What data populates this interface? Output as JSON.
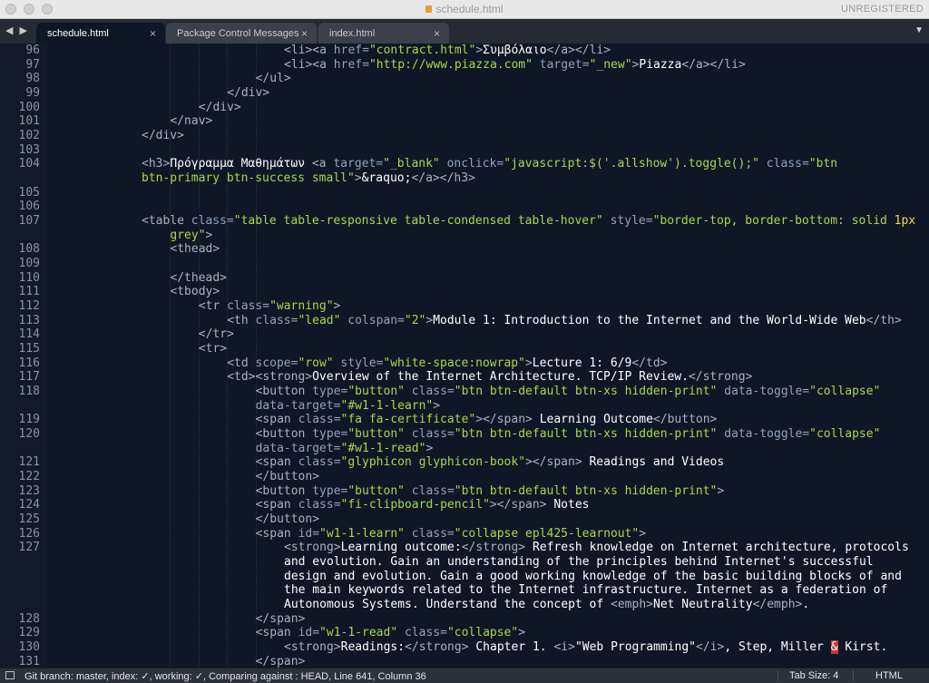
{
  "window": {
    "title": "schedule.html",
    "unregistered": "UNREGISTERED"
  },
  "tabs": [
    {
      "label": "schedule.html",
      "active": true
    },
    {
      "label": "Package Control Messages",
      "active": false
    },
    {
      "label": "index.html",
      "active": false
    }
  ],
  "tab_close": "×",
  "nav_arrows": "◀ ▶",
  "tab_menu": "▼",
  "editor": {
    "lines": [
      {
        "no": "96",
        "indent": 5,
        "tokens": [
          [
            "tg",
            "<li><a "
          ],
          [
            "at",
            "href="
          ],
          [
            "st",
            "\"contract.html\""
          ],
          [
            "tg",
            ">"
          ],
          [
            "tx",
            "Συμβόλαιο"
          ],
          [
            "tg",
            "</a></li>"
          ]
        ]
      },
      {
        "no": "97",
        "indent": 5,
        "tokens": [
          [
            "tg",
            "<li><a "
          ],
          [
            "at",
            "href="
          ],
          [
            "st",
            "\"http://www.piazza.com\""
          ],
          [
            "at",
            " target="
          ],
          [
            "st",
            "\"_new\""
          ],
          [
            "tg",
            ">"
          ],
          [
            "tx",
            "Piazza"
          ],
          [
            "tg",
            "</a></li>"
          ]
        ]
      },
      {
        "no": "98",
        "indent": 4,
        "tokens": [
          [
            "tg",
            "</ul>"
          ]
        ]
      },
      {
        "no": "99",
        "indent": 3,
        "tokens": [
          [
            "tg",
            "</div>"
          ]
        ]
      },
      {
        "no": "100",
        "indent": 2,
        "tokens": [
          [
            "tg",
            "</div>"
          ]
        ]
      },
      {
        "no": "101",
        "indent": 1,
        "tokens": [
          [
            "tg",
            "</nav>"
          ]
        ]
      },
      {
        "no": "102",
        "indent": 0,
        "tokens": [
          [
            "tg",
            "</div>"
          ]
        ]
      },
      {
        "no": "103",
        "indent": 0,
        "tokens": []
      },
      {
        "no": "104",
        "indent": 0,
        "tokens": [
          [
            "tg",
            "<h3>"
          ],
          [
            "tx",
            "Πρόγραμμα Μαθημάτων "
          ],
          [
            "tg",
            "<a "
          ],
          [
            "at",
            "target="
          ],
          [
            "st",
            "\"_blank\""
          ],
          [
            "at",
            " onclick="
          ],
          [
            "st",
            "\"javascript:$('.allshow').toggle();\""
          ],
          [
            "at",
            " class="
          ],
          [
            "st",
            "\"btn"
          ]
        ]
      },
      {
        "no": "",
        "indent": 0,
        "tokens": [
          [
            "st",
            "btn-primary btn-success small\""
          ],
          [
            "tg",
            ">"
          ],
          [
            "tx",
            "&raquo;"
          ],
          [
            "tg",
            "</a></h3>"
          ]
        ]
      },
      {
        "no": "105",
        "indent": 0,
        "tokens": []
      },
      {
        "no": "106",
        "indent": 0,
        "tokens": []
      },
      {
        "no": "107",
        "indent": 0,
        "tokens": [
          [
            "tg",
            "<table "
          ],
          [
            "at",
            "class="
          ],
          [
            "st",
            "\"table table-responsive table-condensed table-hover\""
          ],
          [
            "at",
            " style="
          ],
          [
            "st",
            "\"border-top, border-bottom: solid "
          ],
          [
            "pu",
            "1px"
          ]
        ]
      },
      {
        "no": "",
        "indent": 1,
        "tokens": [
          [
            "st",
            "grey\""
          ],
          [
            "tg",
            ">"
          ]
        ]
      },
      {
        "no": "108",
        "indent": 1,
        "tokens": [
          [
            "tg",
            "<thead>"
          ]
        ]
      },
      {
        "no": "109",
        "indent": 0,
        "tokens": []
      },
      {
        "no": "110",
        "indent": 1,
        "tokens": [
          [
            "tg",
            "</thead>"
          ]
        ]
      },
      {
        "no": "111",
        "indent": 1,
        "tokens": [
          [
            "tg",
            "<tbody>"
          ]
        ]
      },
      {
        "no": "112",
        "indent": 2,
        "tokens": [
          [
            "tg",
            "<tr "
          ],
          [
            "at",
            "class="
          ],
          [
            "st",
            "\"warning\""
          ],
          [
            "tg",
            ">"
          ]
        ]
      },
      {
        "no": "113",
        "indent": 3,
        "tokens": [
          [
            "tg",
            "<th "
          ],
          [
            "at",
            "class="
          ],
          [
            "st",
            "\"lead\""
          ],
          [
            "at",
            " colspan="
          ],
          [
            "st",
            "\"2\""
          ],
          [
            "tg",
            ">"
          ],
          [
            "tx",
            "Module 1: Introduction to the Internet and the World-Wide Web"
          ],
          [
            "tg",
            "</th>"
          ]
        ]
      },
      {
        "no": "114",
        "indent": 2,
        "tokens": [
          [
            "tg",
            "</tr>"
          ]
        ]
      },
      {
        "no": "115",
        "indent": 2,
        "tokens": [
          [
            "tg",
            "<tr>"
          ]
        ]
      },
      {
        "no": "116",
        "indent": 3,
        "tokens": [
          [
            "tg",
            "<td "
          ],
          [
            "at",
            "scope="
          ],
          [
            "st",
            "\"row\""
          ],
          [
            "at",
            " style="
          ],
          [
            "st",
            "\"white-space:nowrap\""
          ],
          [
            "tg",
            ">"
          ],
          [
            "tx",
            "Lecture 1: 6/9"
          ],
          [
            "tg",
            "</td>"
          ]
        ]
      },
      {
        "no": "117",
        "indent": 3,
        "tokens": [
          [
            "tg",
            "<td><strong>"
          ],
          [
            "tx",
            "Overview of the Internet Architecture. TCP/IP Review."
          ],
          [
            "tg",
            "</strong>"
          ]
        ]
      },
      {
        "no": "118",
        "indent": 4,
        "tokens": [
          [
            "tg",
            "<button "
          ],
          [
            "at",
            "type="
          ],
          [
            "st",
            "\"button\""
          ],
          [
            "at",
            " class="
          ],
          [
            "st",
            "\"btn btn-default btn-xs hidden-print\""
          ],
          [
            "at",
            " data-toggle="
          ],
          [
            "st",
            "\"collapse\""
          ]
        ]
      },
      {
        "no": "",
        "indent": 4,
        "tokens": [
          [
            "at",
            "data-target="
          ],
          [
            "st",
            "\"#w1-1-learn\""
          ],
          [
            "tg",
            ">"
          ]
        ]
      },
      {
        "no": "119",
        "indent": 4,
        "tokens": [
          [
            "tg",
            "<span "
          ],
          [
            "at",
            "class="
          ],
          [
            "st",
            "\"fa fa-certificate\""
          ],
          [
            "tg",
            "></span>"
          ],
          [
            "tx",
            " Learning Outcome"
          ],
          [
            "tg",
            "</button>"
          ]
        ]
      },
      {
        "no": "120",
        "indent": 4,
        "tokens": [
          [
            "tg",
            "<button "
          ],
          [
            "at",
            "type="
          ],
          [
            "st",
            "\"button\""
          ],
          [
            "at",
            " class="
          ],
          [
            "st",
            "\"btn btn-default btn-xs hidden-print\""
          ],
          [
            "at",
            " data-toggle="
          ],
          [
            "st",
            "\"collapse\""
          ]
        ]
      },
      {
        "no": "",
        "indent": 4,
        "tokens": [
          [
            "at",
            "data-target="
          ],
          [
            "st",
            "\"#w1-1-read\""
          ],
          [
            "tg",
            ">"
          ]
        ]
      },
      {
        "no": "121",
        "indent": 4,
        "tokens": [
          [
            "tg",
            "<span "
          ],
          [
            "at",
            "class="
          ],
          [
            "st",
            "\"glyphicon glyphicon-book\""
          ],
          [
            "tg",
            "></span>"
          ],
          [
            "tx",
            " Readings and Videos"
          ]
        ]
      },
      {
        "no": "122",
        "indent": 4,
        "tokens": [
          [
            "tg",
            "</button>"
          ]
        ]
      },
      {
        "no": "123",
        "indent": 4,
        "tokens": [
          [
            "tg",
            "<button "
          ],
          [
            "at",
            "type="
          ],
          [
            "st",
            "\"button\""
          ],
          [
            "at",
            " class="
          ],
          [
            "st",
            "\"btn btn-default btn-xs hidden-print\""
          ],
          [
            "tg",
            ">"
          ]
        ]
      },
      {
        "no": "124",
        "indent": 4,
        "tokens": [
          [
            "tg",
            "<span "
          ],
          [
            "at",
            "class="
          ],
          [
            "st",
            "\"fi-clipboard-pencil\""
          ],
          [
            "tg",
            "></span>"
          ],
          [
            "tx",
            " Notes"
          ]
        ]
      },
      {
        "no": "125",
        "indent": 4,
        "tokens": [
          [
            "tg",
            "</button>"
          ]
        ]
      },
      {
        "no": "126",
        "indent": 4,
        "tokens": [
          [
            "tg",
            "<span "
          ],
          [
            "at",
            "id="
          ],
          [
            "st",
            "\"w1-1-learn\""
          ],
          [
            "at",
            " class="
          ],
          [
            "st",
            "\"collapse epl425-learnout\""
          ],
          [
            "tg",
            ">"
          ]
        ]
      },
      {
        "no": "127",
        "indent": 5,
        "tokens": [
          [
            "tg",
            "<strong>"
          ],
          [
            "tx",
            "Learning outcome:"
          ],
          [
            "tg",
            "</strong>"
          ],
          [
            "tx",
            " Refresh knowledge on Internet architecture, protocols"
          ]
        ]
      },
      {
        "no": "",
        "indent": 5,
        "tokens": [
          [
            "tx",
            "and evolution. Gain an understanding of the principles behind Internet's successful"
          ]
        ]
      },
      {
        "no": "",
        "indent": 5,
        "tokens": [
          [
            "tx",
            "design and evolution. Gain a good working knowledge of the basic building blocks of and"
          ]
        ]
      },
      {
        "no": "",
        "indent": 5,
        "tokens": [
          [
            "tx",
            "the main keywords related to the Internet infrastructure. Internet as a federation of"
          ]
        ]
      },
      {
        "no": "",
        "indent": 5,
        "tokens": [
          [
            "tx",
            "Autonomous Systems. Understand the concept of "
          ],
          [
            "tg",
            "<emph>"
          ],
          [
            "tx",
            "Net Neutrality"
          ],
          [
            "tg",
            "</emph>"
          ],
          [
            "tx",
            "."
          ]
        ]
      },
      {
        "no": "128",
        "indent": 4,
        "tokens": [
          [
            "tg",
            "</span>"
          ]
        ]
      },
      {
        "no": "129",
        "indent": 4,
        "tokens": [
          [
            "tg",
            "<span "
          ],
          [
            "at",
            "id="
          ],
          [
            "st",
            "\"w1-1-read\""
          ],
          [
            "at",
            " class="
          ],
          [
            "st",
            "\"collapse\""
          ],
          [
            "tg",
            ">"
          ]
        ]
      },
      {
        "no": "130",
        "indent": 5,
        "tokens": [
          [
            "tg",
            "<strong>"
          ],
          [
            "tx",
            "Readings:"
          ],
          [
            "tg",
            "</strong>"
          ],
          [
            "tx",
            " Chapter 1. "
          ],
          [
            "tg",
            "<i>"
          ],
          [
            "tx",
            "\"Web Programming\""
          ],
          [
            "tg",
            "</i>"
          ],
          [
            "tx",
            ", Step, Miller "
          ],
          [
            "hl",
            "&"
          ],
          [
            "tx",
            " Kirst."
          ]
        ]
      },
      {
        "no": "131",
        "indent": 4,
        "tokens": [
          [
            "tg",
            "</span>"
          ]
        ]
      }
    ]
  },
  "status": {
    "git": "Git branch: master, index: ✓, working: ✓, Comparing against : HEAD, Line 641, Column 36",
    "tab_size": "Tab Size: 4",
    "syntax": "HTML"
  }
}
